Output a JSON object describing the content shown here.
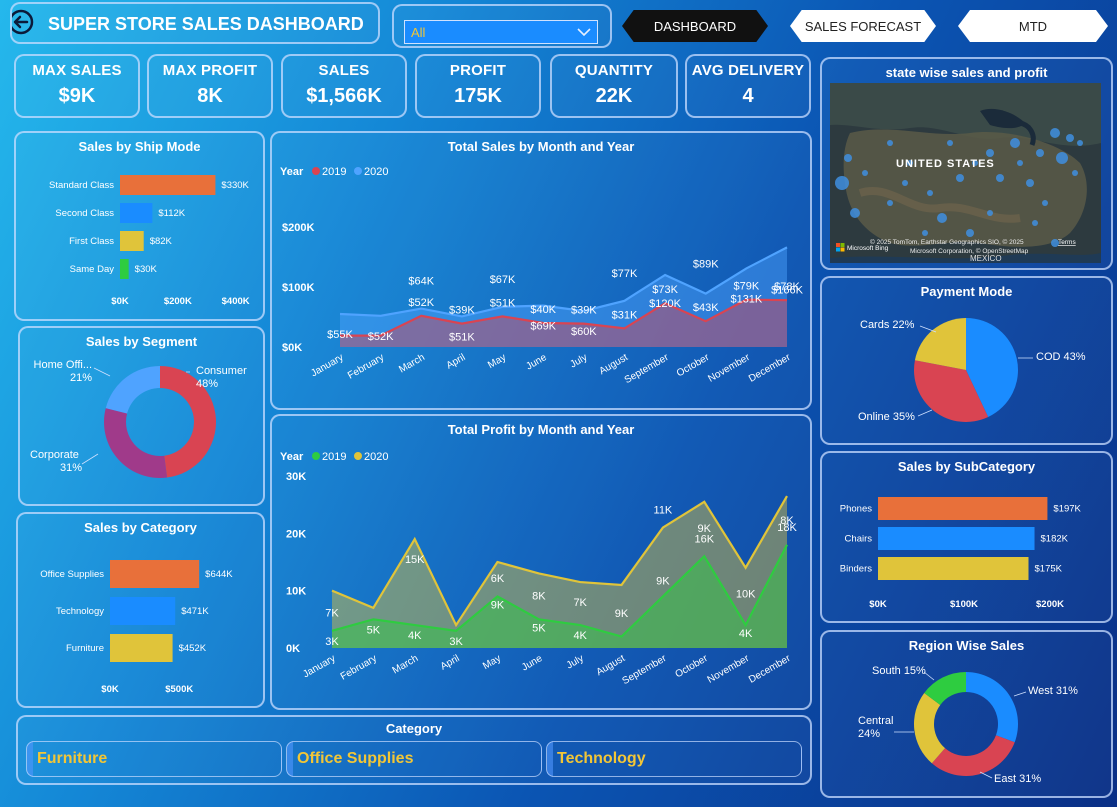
{
  "header": {
    "title": "SUPER STORE SALES DASHBOARD",
    "filter_value": "All",
    "nav": [
      "DASHBOARD",
      "SALES FORECAST",
      "MTD"
    ]
  },
  "kpis": [
    {
      "label": "MAX SALES",
      "value": "$9K"
    },
    {
      "label": "MAX PROFIT",
      "value": "8K"
    },
    {
      "label": "SALES",
      "value": "$1,566K"
    },
    {
      "label": "PROFIT",
      "value": "175K"
    },
    {
      "label": "QUANTITY",
      "value": "22K"
    },
    {
      "label": "AVG DELIVERY",
      "value": "4"
    }
  ],
  "titles": {
    "ship_mode": "Sales by Ship Mode",
    "segment": "Sales by Segment",
    "category": "Sales by Category",
    "sales_month": "Total Sales by Month and Year",
    "profit_month": "Total Profit by Month and Year",
    "map": "state wise sales and profit",
    "payment": "Payment Mode",
    "subcategory": "Sales by SubCategory",
    "region": "Region Wise Sales",
    "category_slicer": "Category"
  },
  "map": {
    "label": "UNITED STATES",
    "credit1": "© 2025 TomTom, Earthstar Geographics SIO, © 2025",
    "credit_terms": "Terms",
    "credit2": "Microsoft Corporation, © OpenStreetMap",
    "bing": "Microsoft Bing",
    "bottom_label": "MEXICO"
  },
  "category_slicer": [
    "Furniture",
    "Office Supplies",
    "Technology"
  ],
  "colors": {
    "orange": "#e8703a",
    "blue": "#1a8cff",
    "yellow": "#e0c43a",
    "green": "#2ecc40",
    "red": "#d94452",
    "magenta": "#a03a8a",
    "lightblue": "#4fa3ff"
  },
  "chart_data": [
    {
      "id": "ship_mode",
      "type": "bar",
      "orientation": "horizontal",
      "categories": [
        "Standard Class",
        "Second Class",
        "First Class",
        "Same Day"
      ],
      "values": [
        330,
        112,
        82,
        30
      ],
      "labels": [
        "$330K",
        "$112K",
        "$82K",
        "$30K"
      ],
      "colors": [
        "#e8703a",
        "#1a8cff",
        "#e0c43a",
        "#2ecc40"
      ],
      "xticks": [
        "$0K",
        "$200K",
        "$400K"
      ],
      "xlim": [
        0,
        460
      ]
    },
    {
      "id": "segment",
      "type": "pie",
      "donut": true,
      "labels": [
        "Consumer",
        "Corporate",
        "Home Offi..."
      ],
      "values": [
        48,
        31,
        21
      ],
      "value_labels": [
        "48%",
        "31%",
        "21%"
      ],
      "colors": [
        "#d94452",
        "#a03a8a",
        "#4fa3ff"
      ]
    },
    {
      "id": "category",
      "type": "bar",
      "orientation": "horizontal",
      "categories": [
        "Office Supplies",
        "Technology",
        "Furniture"
      ],
      "values": [
        644,
        471,
        452
      ],
      "labels": [
        "$644K",
        "$471K",
        "$452K"
      ],
      "colors": [
        "#e8703a",
        "#1a8cff",
        "#e0c43a"
      ],
      "xticks": [
        "$0K",
        "$500K"
      ],
      "xlim": [
        0,
        1300
      ]
    },
    {
      "id": "sales_month",
      "type": "area",
      "legend_title": "Year",
      "categories": [
        "January",
        "February",
        "March",
        "April",
        "May",
        "June",
        "July",
        "August",
        "September",
        "October",
        "November",
        "December"
      ],
      "series": [
        {
          "name": "2019",
          "color": "#d94452",
          "values": [
            19,
            19,
            52,
            39,
            51,
            40,
            39,
            31,
            73,
            43,
            79,
            78
          ],
          "labels": [
            "",
            "",
            "$52K",
            "$39K",
            "$51K",
            "$40K",
            "$39K",
            "$31K",
            "$73K",
            "$43K",
            "$79K",
            "$78K"
          ]
        },
        {
          "name": "2020",
          "color": "#4fa3ff",
          "values": [
            55,
            52,
            64,
            51,
            67,
            69,
            60,
            77,
            120,
            89,
            131,
            166
          ],
          "labels": [
            "$55K",
            "$52K",
            "$64K",
            "$51K",
            "$67K",
            "$69K",
            "$60K",
            "$77K",
            "$120K",
            "$89K",
            "$131K",
            "$166K"
          ]
        }
      ],
      "yticks": [
        "$0K",
        "$100K",
        "$200K"
      ],
      "ylim": [
        0,
        250
      ]
    },
    {
      "id": "profit_month",
      "type": "area",
      "legend_title": "Year",
      "categories": [
        "January",
        "February",
        "March",
        "April",
        "May",
        "June",
        "July",
        "August",
        "September",
        "October",
        "November",
        "December"
      ],
      "series": [
        {
          "name": "2019",
          "color": "#2ecc40",
          "values": [
            3,
            5,
            4,
            3,
            9,
            5,
            4,
            2,
            9,
            16,
            4,
            18
          ],
          "labels": [
            "3K",
            "5K",
            "4K",
            "3K",
            "9K",
            "5K",
            "4K",
            "",
            "9K",
            "16K",
            "4K",
            "18K"
          ]
        },
        {
          "name": "2020",
          "color": "#e0c43a",
          "values": [
            10,
            7,
            19,
            4,
            15,
            13,
            11.5,
            11,
            21,
            25.5,
            14,
            26.5
          ],
          "labels": [
            "7K",
            "",
            "15K",
            "",
            "6K",
            "8K",
            "7K",
            "9K",
            "11K",
            "9K",
            "10K",
            "8K"
          ]
        }
      ],
      "yticks": [
        "0K",
        "10K",
        "20K",
        "30K"
      ],
      "ylim": [
        0,
        30
      ]
    },
    {
      "id": "payment",
      "type": "pie",
      "labels": [
        "COD",
        "Online",
        "Cards"
      ],
      "values": [
        43,
        35,
        22
      ],
      "value_labels": [
        "43%",
        "35%",
        "22%"
      ],
      "colors": [
        "#1a8cff",
        "#d94452",
        "#e0c43a"
      ]
    },
    {
      "id": "subcategory",
      "type": "bar",
      "orientation": "horizontal",
      "categories": [
        "Phones",
        "Chairs",
        "Binders"
      ],
      "values": [
        197,
        182,
        175
      ],
      "labels": [
        "$197K",
        "$182K",
        "$175K"
      ],
      "colors": [
        "#e8703a",
        "#1a8cff",
        "#e0c43a"
      ],
      "xticks": [
        "$0K",
        "$100K",
        "$200K"
      ],
      "xlim": [
        0,
        200
      ]
    },
    {
      "id": "region",
      "type": "pie",
      "donut": true,
      "labels": [
        "West",
        "East",
        "Central",
        "South"
      ],
      "values": [
        31,
        31,
        24,
        15
      ],
      "value_labels": [
        "31%",
        "31%",
        "24%",
        "15%"
      ],
      "colors": [
        "#1a8cff",
        "#d94452",
        "#e0c43a",
        "#2ecc40"
      ]
    }
  ]
}
